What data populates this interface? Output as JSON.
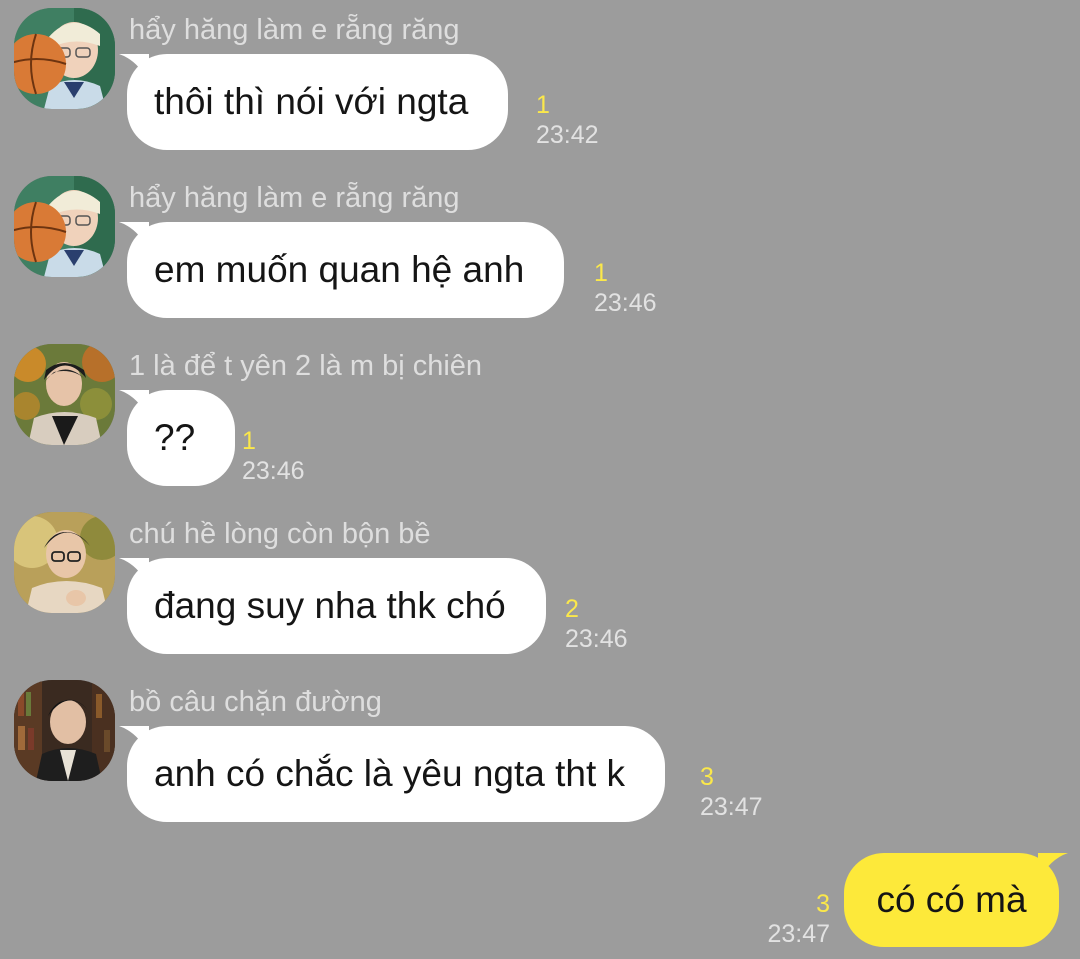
{
  "colors": {
    "background": "#9c9c9c",
    "incoming_bubble": "#ffffff",
    "outgoing_bubble": "#fde93a",
    "unread_count": "#fbe84a",
    "timestamp": "#e2e2e2",
    "sender_name": "#dedede"
  },
  "messages": [
    {
      "sender": "hẩy hăng làm e rẵng răng",
      "avatar": "user-avatar-blond-basketball",
      "text": "thôi thì nói với ngta",
      "count": "1",
      "time": "23:42"
    },
    {
      "sender": "hẩy hăng làm e rẵng răng",
      "avatar": "user-avatar-blond-basketball",
      "text": "em muốn quan hệ anh",
      "count": "1",
      "time": "23:46"
    },
    {
      "sender": "1 là để t yên 2 là m bị chiên",
      "avatar": "user-avatar-dark-hair-autumn",
      "text": "??",
      "count": "1",
      "time": "23:46"
    },
    {
      "sender": "chú hề lòng còn bộn bề",
      "avatar": "user-avatar-glasses-outdoor",
      "text": "đang suy nha thk chó",
      "count": "2",
      "time": "23:46"
    },
    {
      "sender": "bồ câu chặn đường",
      "avatar": "user-avatar-library",
      "text": "anh có chắc là yêu ngta tht k",
      "count": "3",
      "time": "23:47"
    }
  ],
  "outgoing": {
    "text": "có có mà",
    "count": "3",
    "time": "23:47"
  }
}
